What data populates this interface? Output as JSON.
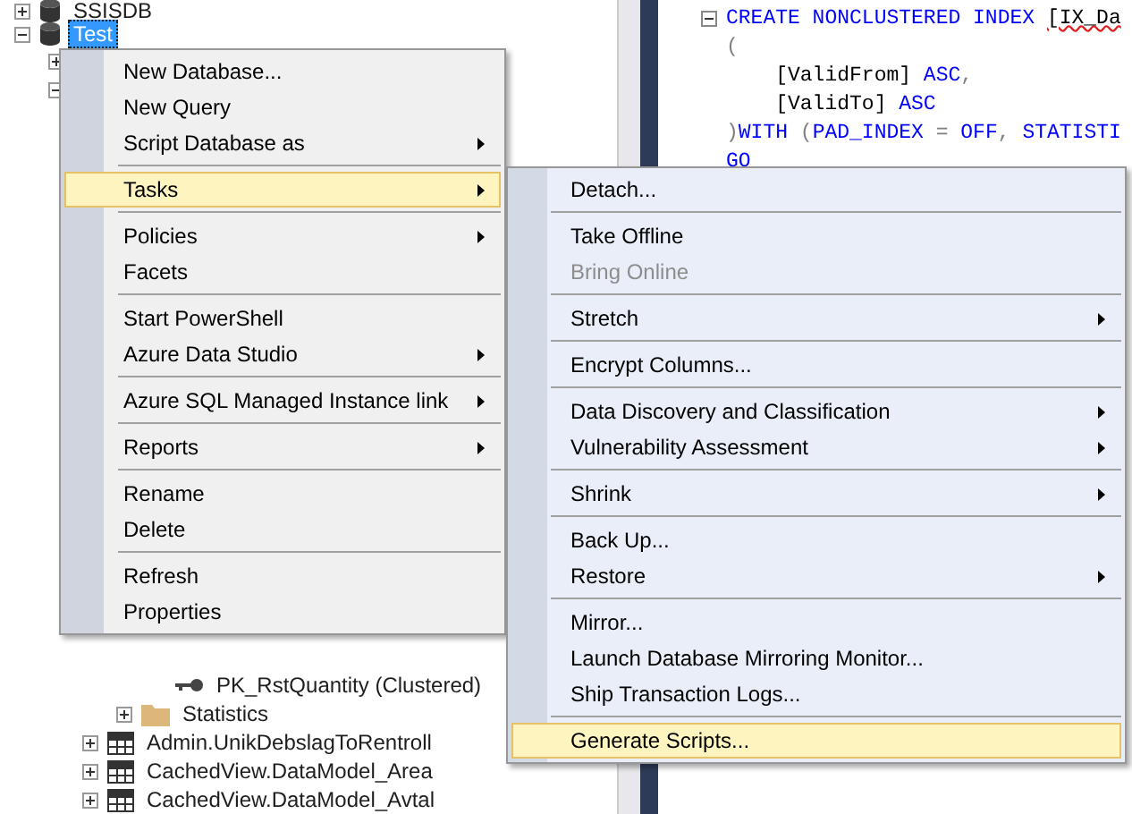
{
  "tree": {
    "nodes": [
      {
        "label": "SSISDB",
        "kind": "database",
        "expanded": false,
        "selected": false
      },
      {
        "label": "Test",
        "kind": "database",
        "expanded": true,
        "selected": true,
        "children": [
          {
            "expanded": false
          },
          {
            "expanded": true,
            "children": [
              {
                "expanded": true,
                "children": [
                  {
                    "expanded": true,
                    "children": [
                      {
                        "label": "PK_RstQuantity (Clustered)",
                        "kind": "key",
                        "selected": false
                      }
                    ]
                  },
                  {
                    "label": "Statistics",
                    "kind": "folder",
                    "expanded": false,
                    "selected": false
                  }
                ]
              },
              {
                "label": "Admin.UnikDebslagToRentroll",
                "kind": "table",
                "expanded": false,
                "selected": false
              },
              {
                "label": "CachedView.DataModel_Area",
                "kind": "table",
                "expanded": false,
                "selected": false
              },
              {
                "label": "CachedView.DataModel_Avtal",
                "kind": "table",
                "expanded": false,
                "selected": false
              }
            ]
          }
        ]
      }
    ]
  },
  "editor": {
    "lines": [
      {
        "fold": true,
        "tokens": [
          {
            "text": "CREATE NONCLUSTERED INDEX ",
            "kind": "keyword"
          },
          {
            "text": "[IX_Da",
            "kind": "error"
          }
        ]
      },
      {
        "tokens": [
          {
            "text": "(",
            "kind": "punct"
          }
        ]
      },
      {
        "tokens": [
          {
            "text": "    [ValidFrom] ",
            "kind": "plain"
          },
          {
            "text": "ASC",
            "kind": "keyword"
          },
          {
            "text": ",",
            "kind": "punct"
          }
        ]
      },
      {
        "tokens": [
          {
            "text": "    [ValidTo] ",
            "kind": "plain"
          },
          {
            "text": "ASC",
            "kind": "keyword"
          }
        ]
      },
      {
        "tokens": [
          {
            "text": ")",
            "kind": "punct"
          },
          {
            "text": "WITH ",
            "kind": "keyword"
          },
          {
            "text": "(",
            "kind": "punct"
          },
          {
            "text": "PAD_INDEX ",
            "kind": "keyword"
          },
          {
            "text": "= ",
            "kind": "punct"
          },
          {
            "text": "OFF",
            "kind": "keyword"
          },
          {
            "text": ", ",
            "kind": "punct"
          },
          {
            "text": "STATISTI",
            "kind": "keyword"
          }
        ]
      },
      {
        "tokens": [
          {
            "text": "GO",
            "kind": "keyword"
          }
        ]
      }
    ]
  },
  "menus": [
    {
      "items": [
        {
          "kind": "item",
          "label": "New Database...",
          "submenu": false,
          "selected": false,
          "disabled": false
        },
        {
          "kind": "item",
          "label": "New Query",
          "submenu": false,
          "selected": false,
          "disabled": false
        },
        {
          "kind": "item",
          "label": "Script Database as",
          "submenu": true,
          "selected": false,
          "disabled": false
        },
        {
          "kind": "separator"
        },
        {
          "kind": "item",
          "label": "Tasks",
          "submenu": true,
          "selected": true,
          "disabled": false
        },
        {
          "kind": "separator"
        },
        {
          "kind": "item",
          "label": "Policies",
          "submenu": true,
          "selected": false,
          "disabled": false
        },
        {
          "kind": "item",
          "label": "Facets",
          "submenu": false,
          "selected": false,
          "disabled": false
        },
        {
          "kind": "separator"
        },
        {
          "kind": "item",
          "label": "Start PowerShell",
          "submenu": false,
          "selected": false,
          "disabled": false
        },
        {
          "kind": "item",
          "label": "Azure Data Studio",
          "submenu": true,
          "selected": false,
          "disabled": false
        },
        {
          "kind": "separator"
        },
        {
          "kind": "item",
          "label": "Azure SQL Managed Instance link",
          "submenu": true,
          "selected": false,
          "disabled": false
        },
        {
          "kind": "separator"
        },
        {
          "kind": "item",
          "label": "Reports",
          "submenu": true,
          "selected": false,
          "disabled": false
        },
        {
          "kind": "separator"
        },
        {
          "kind": "item",
          "label": "Rename",
          "submenu": false,
          "selected": false,
          "disabled": false
        },
        {
          "kind": "item",
          "label": "Delete",
          "submenu": false,
          "selected": false,
          "disabled": false
        },
        {
          "kind": "separator"
        },
        {
          "kind": "item",
          "label": "Refresh",
          "submenu": false,
          "selected": false,
          "disabled": false
        },
        {
          "kind": "item",
          "label": "Properties",
          "submenu": false,
          "selected": false,
          "disabled": false
        }
      ]
    },
    {
      "items": [
        {
          "kind": "item",
          "label": "Detach...",
          "submenu": false,
          "selected": false,
          "disabled": false
        },
        {
          "kind": "separator"
        },
        {
          "kind": "item",
          "label": "Take Offline",
          "submenu": false,
          "selected": false,
          "disabled": false
        },
        {
          "kind": "item",
          "label": "Bring Online",
          "submenu": false,
          "selected": false,
          "disabled": true
        },
        {
          "kind": "separator"
        },
        {
          "kind": "item",
          "label": "Stretch",
          "submenu": true,
          "selected": false,
          "disabled": false
        },
        {
          "kind": "separator"
        },
        {
          "kind": "item",
          "label": "Encrypt Columns...",
          "submenu": false,
          "selected": false,
          "disabled": false
        },
        {
          "kind": "separator"
        },
        {
          "kind": "item",
          "label": "Data Discovery and Classification",
          "submenu": true,
          "selected": false,
          "disabled": false
        },
        {
          "kind": "item",
          "label": "Vulnerability Assessment",
          "submenu": true,
          "selected": false,
          "disabled": false
        },
        {
          "kind": "separator"
        },
        {
          "kind": "item",
          "label": "Shrink",
          "submenu": true,
          "selected": false,
          "disabled": false
        },
        {
          "kind": "separator"
        },
        {
          "kind": "item",
          "label": "Back Up...",
          "submenu": false,
          "selected": false,
          "disabled": false
        },
        {
          "kind": "item",
          "label": "Restore",
          "submenu": true,
          "selected": false,
          "disabled": false
        },
        {
          "kind": "separator"
        },
        {
          "kind": "item",
          "label": "Mirror...",
          "submenu": false,
          "selected": false,
          "disabled": false
        },
        {
          "kind": "item",
          "label": "Launch Database Mirroring Monitor...",
          "submenu": false,
          "selected": false,
          "disabled": false
        },
        {
          "kind": "item",
          "label": "Ship Transaction Logs...",
          "submenu": false,
          "selected": false,
          "disabled": false
        },
        {
          "kind": "separator"
        },
        {
          "kind": "item",
          "label": "Generate Scripts...",
          "submenu": false,
          "selected": true,
          "disabled": false
        }
      ]
    }
  ]
}
